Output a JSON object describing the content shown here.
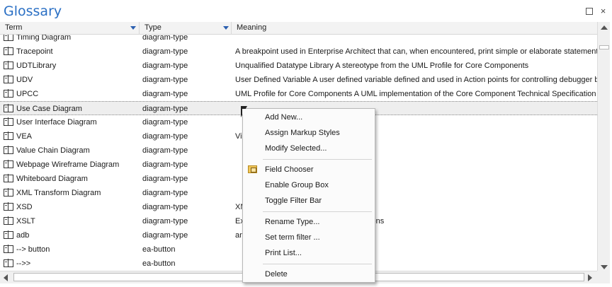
{
  "window": {
    "title": "Glossary",
    "restore_icon": "restore-icon",
    "close_icon": "close-icon",
    "close_glyph": "×"
  },
  "columns": {
    "term": "Term",
    "type": "Type",
    "meaning": "Meaning"
  },
  "rows": [
    {
      "term": "Timing Diagram",
      "type": "diagram-type",
      "meaning": ""
    },
    {
      "term": "Tracepoint",
      "type": "diagram-type",
      "meaning": "A breakpoint used in Enterprise Architect that can, when encountered, print simple or elaborate statement"
    },
    {
      "term": "UDTLibrary",
      "type": "diagram-type",
      "meaning": "Unqualified Datatype Library A stereotype from the UML Profile for Core Components"
    },
    {
      "term": "UDV",
      "type": "diagram-type",
      "meaning": "User Defined Variable A user defined variable defined and used in Action points for controlling debugger be"
    },
    {
      "term": "UPCC",
      "type": "diagram-type",
      "meaning": "UML Profile for Core Components A UML implementation of the Core Component Technical Specification"
    },
    {
      "term": "Use Case Diagram",
      "type": "diagram-type",
      "meaning": "",
      "selected": true
    },
    {
      "term": "User Interface Diagram",
      "type": "diagram-type",
      "meaning": ""
    },
    {
      "term": "VEA",
      "type": "diagram-type",
      "meaning": "Vis"
    },
    {
      "term": "Value Chain Diagram",
      "type": "diagram-type",
      "meaning": ""
    },
    {
      "term": "Webpage Wireframe Diagram",
      "type": "diagram-type",
      "meaning": ""
    },
    {
      "term": "Whiteboard Diagram",
      "type": "diagram-type",
      "meaning": ""
    },
    {
      "term": "XML Transform Diagram",
      "type": "diagram-type",
      "meaning": ""
    },
    {
      "term": "XSD",
      "type": "diagram-type",
      "meaning": "XN"
    },
    {
      "term": "XSLT",
      "type": "diagram-type",
      "meaning": "Ex                                                    mations"
    },
    {
      "term": "adb",
      "type": "diagram-type",
      "meaning": "an"
    },
    {
      "term": "--> button",
      "type": "ea-button",
      "meaning": ""
    },
    {
      "term": "-->>",
      "type": "ea-button",
      "meaning": ""
    }
  ],
  "context_menu": {
    "items": [
      {
        "label": "Add New..."
      },
      {
        "label": "Assign Markup Styles"
      },
      {
        "label": "Modify Selected..."
      },
      {
        "label": "Field Chooser",
        "icon": "field-chooser-icon"
      },
      {
        "label": "Enable Group Box"
      },
      {
        "label": "Toggle Filter Bar"
      },
      {
        "label": "Rename Type..."
      },
      {
        "label": "Set term filter ..."
      },
      {
        "label": "Print List..."
      },
      {
        "label": "Delete"
      }
    ]
  },
  "colors": {
    "title": "#2a6fc4",
    "header_bg": "#f3f3f3",
    "selected_row": "#eeeeee",
    "sort_arrow": "#2b5fb0"
  }
}
